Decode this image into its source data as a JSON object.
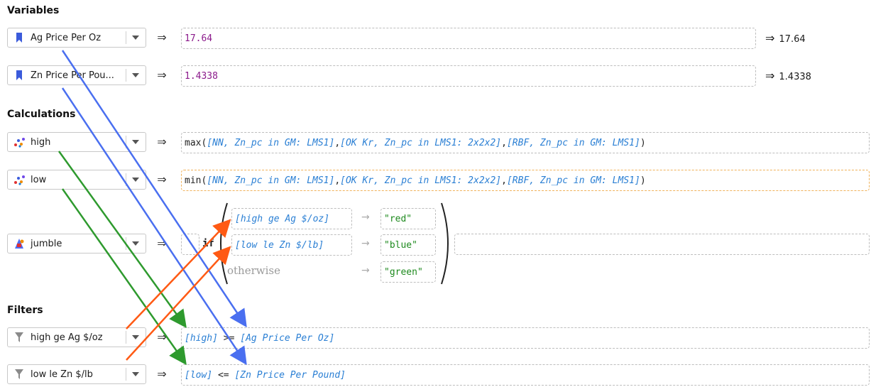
{
  "sections": {
    "variables": "Variables",
    "calculations": "Calculations",
    "filters": "Filters"
  },
  "implies_symbol": "⇒",
  "map_arrow": "→",
  "variables": [
    {
      "label": "Ag Price Per Oz",
      "icon": "bookmark-icon",
      "value": "17.64",
      "result": "17.64"
    },
    {
      "label": "Zn Price Per Pou...",
      "icon": "bookmark-icon",
      "value": "1.4338",
      "result": "1.4338"
    }
  ],
  "calculations": {
    "high": {
      "label": "high",
      "icon": "scatter-icon",
      "expr": {
        "fn": "max(",
        "a": "[NN, Zn_pc in GM: LMS1]",
        "c1": ", ",
        "b": "[OK Kr, Zn_pc in LMS1: 2x2x2]",
        "c2": ", ",
        "c": "[RBF, Zn_pc in GM: LMS1]",
        "end": ")"
      }
    },
    "low": {
      "label": "low",
      "icon": "scatter-icon",
      "expr": {
        "fn": "min(",
        "a": "[NN, Zn_pc in GM: LMS1]",
        "c1": ", ",
        "b": "[OK Kr, Zn_pc in LMS1: 2x2x2]",
        "c2": ", ",
        "c": "[RBF, Zn_pc in GM: LMS1]",
        "end": ")"
      }
    },
    "jumble": {
      "label": "jumble",
      "icon": "category-icon",
      "if_keyword": "if",
      "conditions": [
        {
          "cond": "[high ge Ag $/oz]",
          "value": "\"red\""
        },
        {
          "cond": "[low le Zn $/lb]",
          "value": "\"blue\""
        }
      ],
      "otherwise_label": "otherwise",
      "otherwise_value": "\"green\""
    }
  },
  "filters": [
    {
      "label": "high ge Ag $/oz",
      "icon": "filter-icon",
      "expr": {
        "a": "[high]",
        "op": " >= ",
        "b": "[Ag Price Per Oz]"
      }
    },
    {
      "label": "low le Zn $/lb",
      "icon": "filter-icon",
      "expr": {
        "a": "[low]",
        "op": " <= ",
        "b": "[Zn Price Per Pound]"
      }
    }
  ],
  "colors": {
    "blue_arrow": "#4a6ff0",
    "green_arrow": "#2e9a2e",
    "orange_arrow": "#ff5a14",
    "number": "#8b1a8b",
    "reference": "#2a7fd4",
    "string": "#1e8a1e"
  }
}
